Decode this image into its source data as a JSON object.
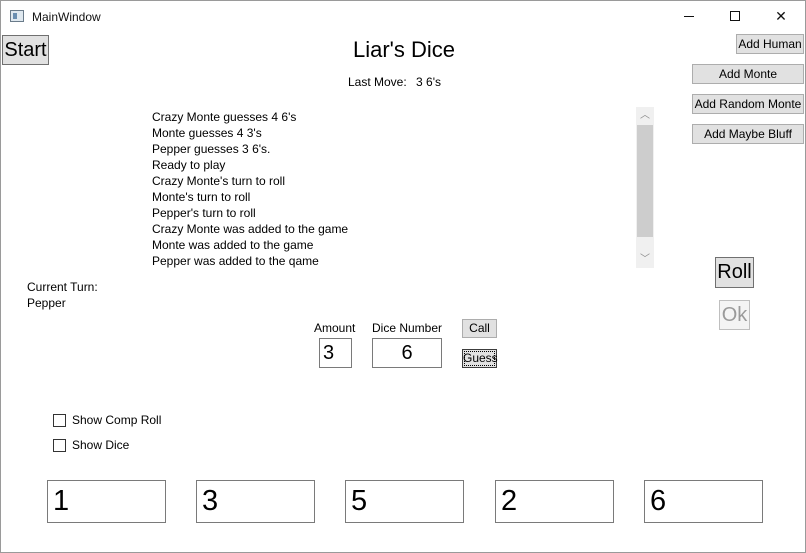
{
  "window": {
    "title": "MainWindow",
    "close_glyph": "✕"
  },
  "heading": "Liar's Dice",
  "last_move": {
    "label": "Last Move:",
    "value": "3 6's"
  },
  "buttons": {
    "start": "Start",
    "add_human": "Add Human",
    "add_monte": "Add Monte",
    "add_random_monte": "Add Random Monte",
    "add_maybe_bluff": "Add Maybe Bluff",
    "roll": "Roll",
    "ok": "Ok",
    "call": "Call",
    "guess": "Guess"
  },
  "log": [
    "Crazy Monte guesses 4 6's",
    "Monte guesses 4 3's",
    "Pepper guesses 3 6's.",
    "Ready to play",
    "Crazy Monte's turn to roll",
    "Monte's turn to roll",
    "Pepper's turn to roll",
    "Crazy Monte was added to the game",
    "Monte was added to the game",
    "Pepper was added to the qame"
  ],
  "current_turn": {
    "label": "Current Turn:",
    "value": "Pepper"
  },
  "guess_form": {
    "amount_label": "Amount",
    "amount_value": "3",
    "dice_number_label": "Dice Number",
    "dice_number_value": "6"
  },
  "options": {
    "show_comp_roll": {
      "label": "Show Comp Roll",
      "checked": false
    },
    "show_dice": {
      "label": "Show Dice",
      "checked": false
    }
  },
  "dice": [
    "1",
    "3",
    "5",
    "2",
    "6"
  ]
}
